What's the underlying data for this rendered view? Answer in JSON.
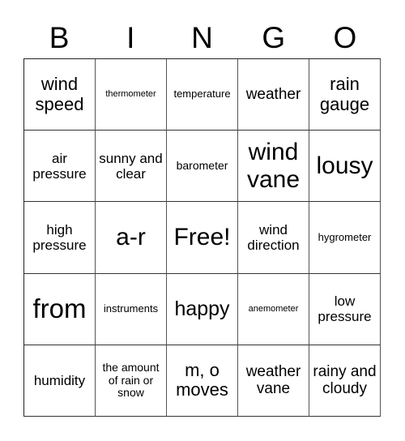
{
  "header": {
    "letters": [
      "B",
      "I",
      "N",
      "G",
      "O"
    ]
  },
  "cells": [
    [
      "wind speed",
      "thermometer",
      "temperature",
      "weather",
      "rain gauge"
    ],
    [
      "air pressure",
      "sunny and clear",
      "barometer",
      "wind vane",
      "lousy"
    ],
    [
      "high pressure",
      "a-r",
      "Free!",
      "wind direction",
      "hygrometer"
    ],
    [
      "from",
      "instruments",
      "happy",
      "anemometer",
      "low pressure"
    ],
    [
      "humidity",
      "the amount of rain or snow",
      "m, o moves",
      "weather vane",
      "rainy and cloudy"
    ]
  ]
}
